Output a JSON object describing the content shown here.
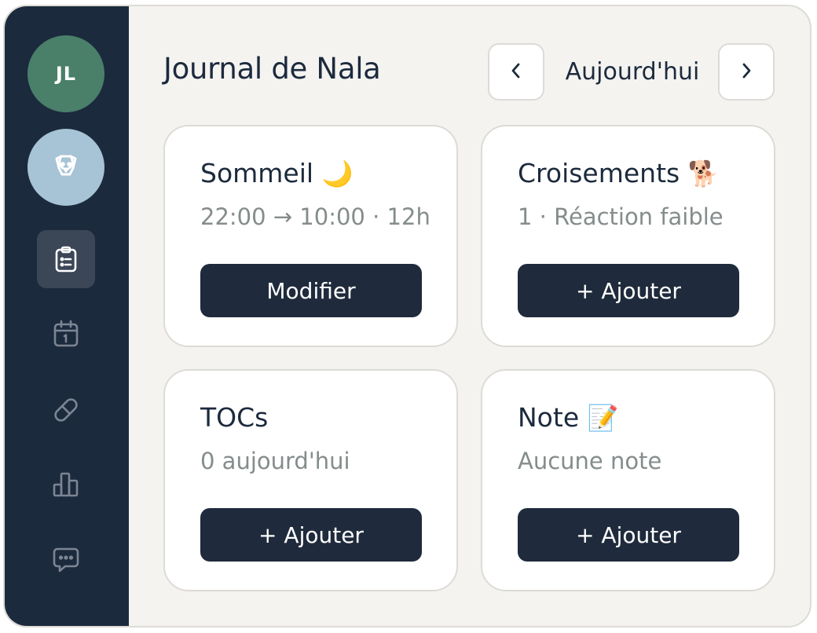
{
  "sidebar": {
    "user_initials": "JL",
    "pet_icon": "dog-icon",
    "nav": [
      {
        "icon": "clipboard-list-icon",
        "active": true
      },
      {
        "icon": "calendar-icon",
        "active": false
      },
      {
        "icon": "pill-icon",
        "active": false
      },
      {
        "icon": "bar-chart-icon",
        "active": false
      },
      {
        "icon": "message-icon",
        "active": false
      }
    ]
  },
  "header": {
    "title": "Journal de Nala",
    "prev_icon": "chevron-left-icon",
    "date_label": "Aujourd'hui",
    "next_icon": "chevron-right-icon"
  },
  "cards": [
    {
      "title": "Sommeil",
      "emoji": "🌙",
      "subtitle": "22:00 → 10:00 · 12h",
      "button": "Modifier"
    },
    {
      "title": "Croisements",
      "emoji": "🐕",
      "subtitle": "1 · Réaction faible",
      "button": "+ Ajouter"
    },
    {
      "title": "TOCs",
      "emoji": "",
      "subtitle": "0 aujourd'hui",
      "button": "+ Ajouter"
    },
    {
      "title": "Note",
      "emoji": "📝",
      "subtitle": "Aucune note",
      "button": "+ Ajouter"
    }
  ],
  "colors": {
    "sidebar_bg": "#1c2a3d",
    "page_bg": "#f4f3f0",
    "avatar_user": "#4a7f6a",
    "avatar_pet": "#a7c3d6",
    "button_bg": "#1f2b3c",
    "muted_text": "#858c8c"
  }
}
